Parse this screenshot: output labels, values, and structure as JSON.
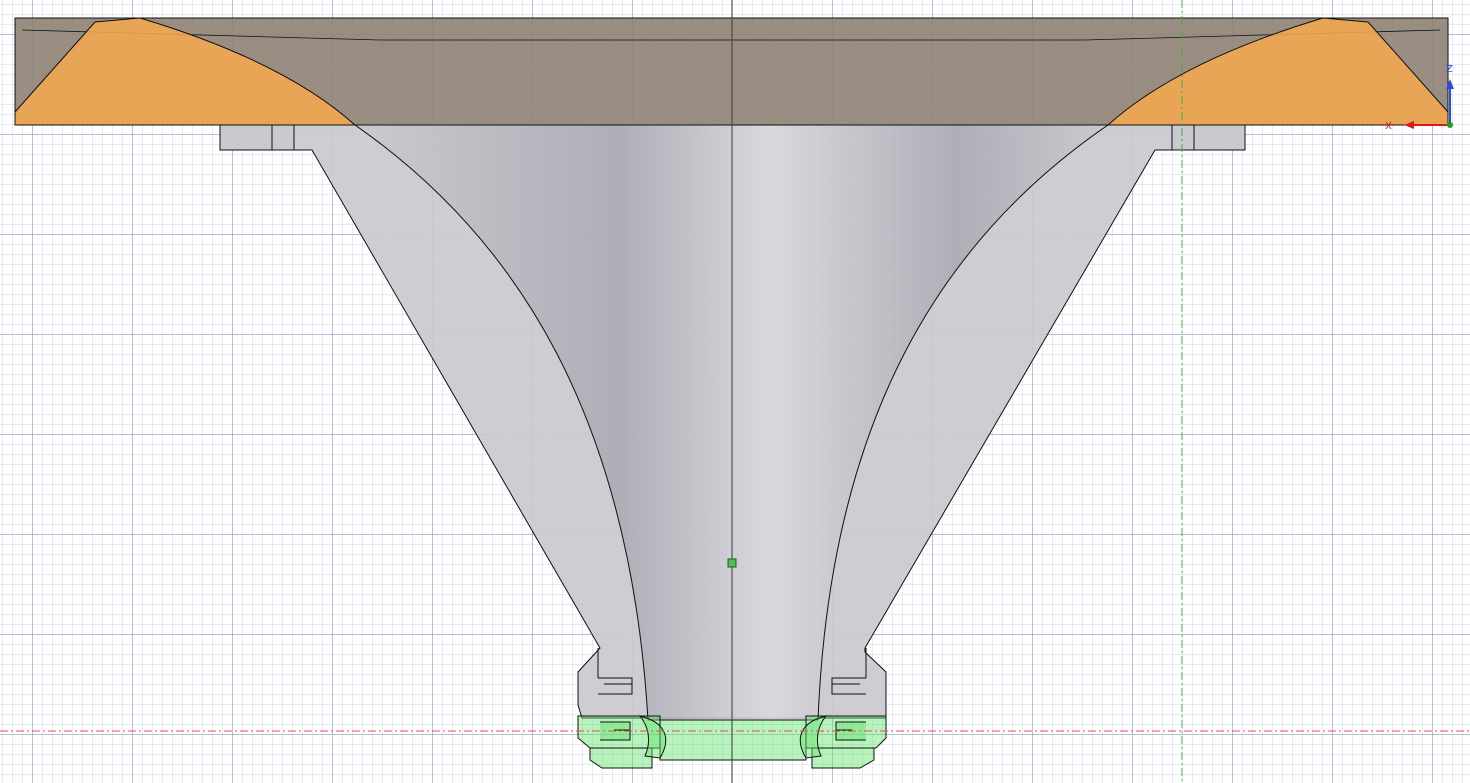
{
  "viewport": {
    "background": "#ffffff",
    "grid_minor_color": "#c4c8e6",
    "grid_major_color": "#8e94c8"
  },
  "model": {
    "flange_color": "#8f8274",
    "fillet_color": "#f2a94e",
    "horn_color": "#c9c9cf",
    "horn_shade_color": "#a9a9b2",
    "selection_color": "#62e26a",
    "edge_color": "#111111"
  },
  "axes": {
    "x_color": "#e01818",
    "z_color": "#2a4de0",
    "origin_color": "#1aa31a",
    "x_label": "X",
    "z_label": "Z",
    "vertical_axis_color": "#3c3c3c",
    "horizontal_construction_color": "#e05050",
    "vertical_construction_color": "#40b040"
  },
  "icons": {
    "sketch_point": "sketch-point-icon",
    "triad": "view-axis-triad-icon"
  }
}
